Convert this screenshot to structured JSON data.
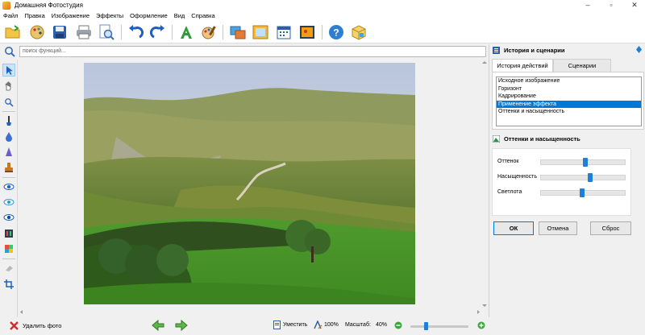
{
  "window": {
    "title": "Домашняя Фотостудия",
    "controls": [
      "–",
      "▫",
      "✕"
    ]
  },
  "menu": [
    "Файл",
    "Правка",
    "Изображение",
    "Эффекты",
    "Оформление",
    "Вид",
    "Справка"
  ],
  "search": {
    "placeholder": "поиск функций..."
  },
  "history_panel": {
    "title": "История и сценарии",
    "tabs": [
      "История действий",
      "Сценарии"
    ],
    "items": [
      "Исходное изображение",
      "Горизонт",
      "Кадрирование",
      "Применение эффекта",
      "Оттенки и насыщенность"
    ],
    "selected_index": 3
  },
  "adjust_panel": {
    "title": "Оттенки и насыщенность",
    "sliders": [
      {
        "label": "Оттенок",
        "value": 0.52
      },
      {
        "label": "Насыщенность",
        "value": 0.58
      },
      {
        "label": "Светлота",
        "value": 0.48
      }
    ],
    "buttons": {
      "ok": "ОК",
      "cancel": "Отмена",
      "reset": "Сброс"
    }
  },
  "bottom": {
    "delete_photo": "Удалить фото",
    "fit": "Уместить",
    "zoom_100": "100%",
    "scale_label": "Масштаб:",
    "scale_value": "40%",
    "zoom_slider": 0.25
  },
  "colors": {
    "accent": "#0078d7",
    "slider_thumb": "#1e7fd6"
  }
}
